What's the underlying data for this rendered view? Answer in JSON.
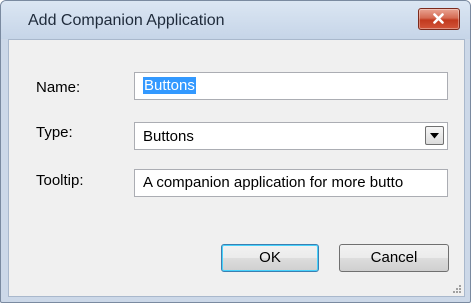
{
  "dialog": {
    "title": "Add Companion Application",
    "fields": {
      "name_label": "Name:",
      "name_value": "Buttons",
      "type_label": "Type:",
      "type_value": "Buttons",
      "tooltip_label": "Tooltip:",
      "tooltip_value": "A companion application for more butto"
    },
    "buttons": {
      "ok_label": "OK",
      "cancel_label": "Cancel"
    }
  },
  "icons": {
    "close": "close-icon",
    "dropdown": "chevron-down-icon",
    "resize": "resize-grip-icon"
  },
  "colors": {
    "selection": "#3399ff",
    "close_button": "#c23a1f"
  }
}
